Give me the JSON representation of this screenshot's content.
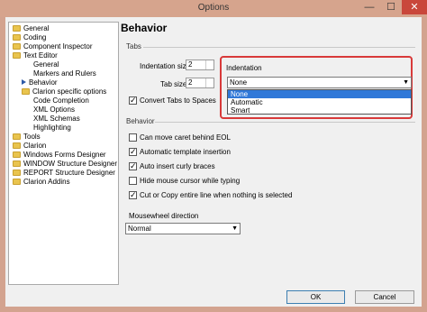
{
  "window": {
    "title": "Options"
  },
  "titlebar": {
    "minimize": "—",
    "maximize": "☐",
    "close": "✕"
  },
  "tree": {
    "items": [
      {
        "label": "General",
        "type": "folder"
      },
      {
        "label": "Coding",
        "type": "folder"
      },
      {
        "label": "Component Inspector",
        "type": "folder"
      },
      {
        "label": "Text Editor",
        "type": "folder-open"
      },
      {
        "label": "General",
        "type": "child"
      },
      {
        "label": "Markers and Rulers",
        "type": "child"
      },
      {
        "label": "Behavior",
        "type": "child-selected"
      },
      {
        "label": "Clarion specific options",
        "type": "child-folder"
      },
      {
        "label": "Code Completion",
        "type": "grandchild"
      },
      {
        "label": "XML Options",
        "type": "grandchild"
      },
      {
        "label": "XML Schemas",
        "type": "grandchild"
      },
      {
        "label": "Highlighting",
        "type": "grandchild"
      },
      {
        "label": "Tools",
        "type": "folder"
      },
      {
        "label": "Clarion",
        "type": "folder"
      },
      {
        "label": "Windows Forms Designer",
        "type": "folder"
      },
      {
        "label": "WINDOW Structure Designer",
        "type": "folder"
      },
      {
        "label": "REPORT Structure Designer",
        "type": "folder"
      },
      {
        "label": "Clarion Addins",
        "type": "folder"
      }
    ]
  },
  "page": {
    "title": "Behavior"
  },
  "tabs_group": {
    "label": "Tabs",
    "indentation_size_label": "Indentation size",
    "indentation_size_value": "2",
    "tab_size_label": "Tab size",
    "tab_size_value": "2",
    "convert_tabs_label": "Convert Tabs to Spaces",
    "convert_tabs_checked": true
  },
  "indentation": {
    "label": "Indentation",
    "selected": "None",
    "options": [
      "None",
      "Automatic",
      "Smart"
    ]
  },
  "behavior_group": {
    "label": "Behavior",
    "checkboxes": [
      {
        "label": "Can move caret behind EOL",
        "checked": false
      },
      {
        "label": "Automatic template insertion",
        "checked": true
      },
      {
        "label": "Auto insert curly braces",
        "checked": true
      },
      {
        "label": "Hide mouse cursor while typing",
        "checked": false
      },
      {
        "label": "Cut or Copy entire line when nothing is selected",
        "checked": true
      }
    ],
    "mousewheel_label": "Mousewheel direction",
    "mousewheel_value": "Normal"
  },
  "buttons": {
    "ok": "OK",
    "cancel": "Cancel"
  }
}
